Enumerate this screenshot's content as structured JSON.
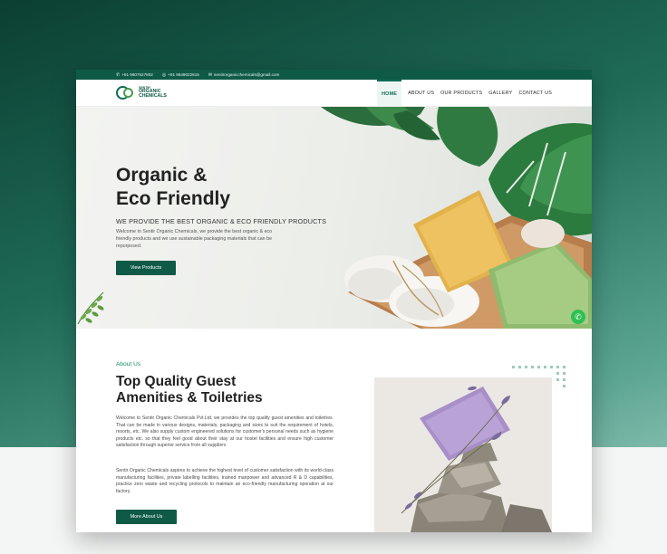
{
  "topbar": {
    "phone1": "+91 9607527802",
    "phone2": "+91 9849022815",
    "email": "sentirorganicchemicals@gmail.com"
  },
  "logo": {
    "line1": "SENTIR",
    "line2": "ORGANIC",
    "line3": "CHEMICALS"
  },
  "nav": {
    "items": [
      "HOME",
      "ABOUT US",
      "OUR PRODUCTS",
      "GALLERY",
      "CONTACT US"
    ]
  },
  "hero": {
    "title_line1": "Organic &",
    "title_line2": "Eco Friendly",
    "subtitle": "WE PROVIDE THE BEST ORGANIC & ECO FRIENDLY PRODUCTS",
    "description": "Welcome to Sentir Organic Chemicals, we provide the best organic & eco friendly products and we use sustainable packaging materials that can be repurposed.",
    "button": "View Products"
  },
  "about": {
    "kicker": "About Us",
    "title_line1": "Top Quality Guest",
    "title_line2": "Amenities & Toiletries",
    "paragraph1": "Welcome to Sentir Organic Chemicals Pvt.Ltd, we provides the top quality guest amenities and toiletries. That can be made in various designs, materials, packaging and sizes to suit the requirement of hotels, resorts, etc. We also supply custom engineered solutions for customer's personal needs such as hygiene products etc. so that they feel good about their stay at our hostel facilities and ensure high customer satisfaction through superior service from all suppliers",
    "paragraph2": "Sentir Organic Chemicals aspires to achieve the highest level of customer satisfaction with its world-class manufacturing facilities, private labelling facilities, trained manpower and advanced R & D capabilities, practice zero waste and recycling protocols to maintain an eco-friendly manufacturing operation at our factory.",
    "button": "More About Us"
  },
  "colors": {
    "brand": "#0f5a47",
    "accent": "#1a8a66",
    "whatsapp": "#2fbf52"
  },
  "icons": {
    "phone": "phone-icon",
    "whatsapp": "whatsapp-icon",
    "email": "email-icon"
  }
}
